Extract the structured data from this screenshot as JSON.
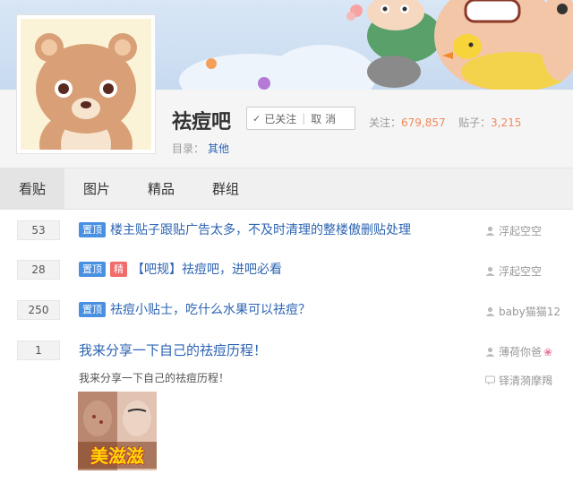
{
  "forum": {
    "name": "祛痘吧",
    "follow_label": "已关注",
    "cancel_label": "取 消",
    "followers_label": "关注：",
    "followers_value": "679,857",
    "posts_label": "贴子：",
    "posts_value": "3,215",
    "directory_label": "目录：",
    "directory_value": "其他"
  },
  "tabs": [
    {
      "label": "看贴"
    },
    {
      "label": "图片"
    },
    {
      "label": "精品"
    },
    {
      "label": "群组"
    }
  ],
  "threads": [
    {
      "replies": "53",
      "badges": [
        "置顶"
      ],
      "title": "楼主贴子跟贴广告太多，不及时清理的整楼傲删贴处理",
      "author": "浮起空空"
    },
    {
      "replies": "28",
      "badges": [
        "置顶",
        "精"
      ],
      "title": "【吧规】祛痘吧，进吧必看",
      "author": "浮起空空"
    },
    {
      "replies": "250",
      "badges": [
        "置顶"
      ],
      "title": "祛痘小贴士，吃什么水果可以祛痘？",
      "author": "baby猫猫12"
    },
    {
      "replies": "1",
      "badges": [],
      "title": "我来分享一下自己的祛痘历程！",
      "author": "薄荷你爸",
      "excerpt": "我来分享一下自己的祛痘历程！",
      "last_reply": "铎清漪摩羯",
      "thumb_text": "美滋滋"
    }
  ],
  "colors": {
    "link": "#2d64b3",
    "top_badge": "#4a90e2",
    "good_badge": "#f26b6b",
    "stat_value": "#f28a5a"
  }
}
